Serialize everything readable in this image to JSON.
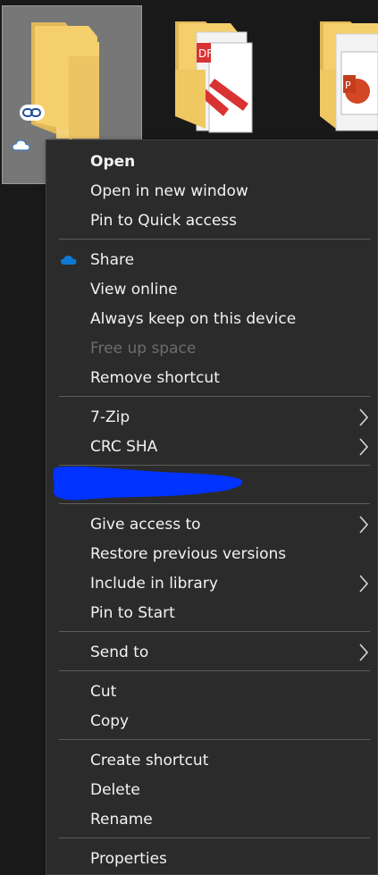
{
  "colors": {
    "menu_bg": "#2b2b2b",
    "text": "#f2f2f2",
    "disabled_text": "#6d6d6d",
    "separator": "#5c5c5c",
    "onedrive_blue": "#0f78d4",
    "redaction_blue": "#0033ff",
    "folder_yellow": "#f4cf6b"
  },
  "files": [
    {
      "icon": "folder-icon",
      "badges": [
        "link-icon",
        "cloud-icon"
      ],
      "selected": true
    },
    {
      "icon": "pdf-folder-icon",
      "selected": false
    },
    {
      "icon": "powerpoint-folder-icon",
      "selected": false
    }
  ],
  "menu": {
    "open": "Open",
    "open_new_window": "Open in new window",
    "pin_quick_access": "Pin to Quick access",
    "share": "Share",
    "view_online": "View online",
    "always_keep": "Always keep on this device",
    "free_up_space": "Free up space",
    "remove_shortcut": "Remove shortcut",
    "seven_zip": "7-Zip",
    "crc_sha": "CRC SHA",
    "give_access": "Give access to",
    "restore_versions": "Restore previous versions",
    "include_library": "Include in library",
    "pin_start": "Pin to Start",
    "send_to": "Send to",
    "cut": "Cut",
    "copy": "Copy",
    "create_shortcut": "Create shortcut",
    "delete": "Delete",
    "rename": "Rename",
    "properties": "Properties"
  }
}
